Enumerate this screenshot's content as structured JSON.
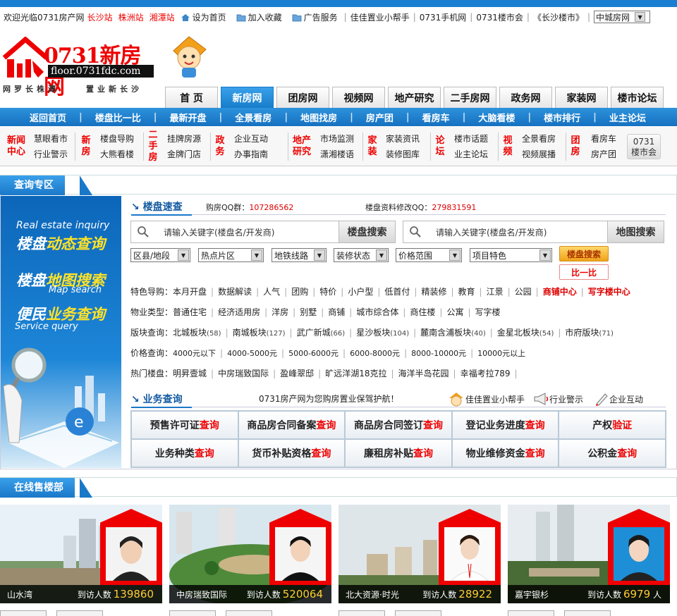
{
  "topbar": {
    "welcome": "欢迎光临0731房产网",
    "sites": [
      "长沙站",
      "株洲站",
      "湘潭站"
    ],
    "links": [
      "设为首页",
      "加入收藏",
      "广告服务"
    ],
    "text_links": [
      "佳佳置业小帮手",
      "0731手机网",
      "0731楼市会",
      "《长沙楼市》"
    ],
    "select_value": "中城房网"
  },
  "logo": {
    "brand": "0731新房网",
    "domain": "floor.0731fdc.com",
    "slogan_left": "网罗长株潭",
    "slogan_right": "置业新长沙"
  },
  "tabs": [
    "首 页",
    "新房网",
    "团房网",
    "视频网",
    "地产研究",
    "二手房网",
    "政务网",
    "家装网",
    "楼市论坛"
  ],
  "active_tab_index": 1,
  "nav": [
    "返回首页",
    "楼盘比一比",
    "最新开盘",
    "全景看房",
    "地图找房",
    "房产团",
    "看房车",
    "大脑看楼",
    "楼市排行",
    "业主论坛"
  ],
  "subnav": [
    {
      "cat": "新闻中心",
      "links": [
        "慧眼看市",
        "行业警示"
      ]
    },
    {
      "cat": "新房",
      "links": [
        "楼盘导购",
        "大熊看楼"
      ]
    },
    {
      "cat": "二手房",
      "links": [
        "挂牌房源",
        "金牌门店"
      ]
    },
    {
      "cat": "政务",
      "links": [
        "企业互动",
        "办事指南"
      ]
    },
    {
      "cat": "地产研究",
      "links": [
        "市场监测",
        "潇湘楼语"
      ]
    },
    {
      "cat": "家装",
      "links": [
        "家装资讯",
        "装修图库"
      ]
    },
    {
      "cat": "论坛",
      "links": [
        "楼市话题",
        "业主论坛"
      ]
    },
    {
      "cat": "视频",
      "links": [
        "全景看房",
        "视频展播"
      ]
    },
    {
      "cat": "团房",
      "links": [
        "看房车",
        "房产团"
      ]
    }
  ],
  "club_button": [
    "0731",
    "楼市会"
  ],
  "query_section": {
    "title": "查询专区"
  },
  "banner": {
    "en1": "Real estate inquiry",
    "cn1a": "楼盘",
    "cn1b": "动态查询",
    "cn2a": "楼盘",
    "cn2b": "地图搜索",
    "en2": "Map search",
    "cn3a": "便民",
    "cn3b": "业务查询",
    "en3": "Service query"
  },
  "quick": {
    "title": "楼盘速查",
    "qq_label": "购房QQ群：",
    "qq_value": "107286562",
    "edit_label": "楼盘资料修改QQ：",
    "edit_value": "279831591",
    "search1_placeholder": "请输入关键字(楼盘名/开发商)",
    "search1_button": "楼盘搜索",
    "search2_placeholder": "请输入关键字(楼盘名/开发商)",
    "search2_button": "地图搜索",
    "filters": [
      "区县/地段",
      "热点片区",
      "地铁线路",
      "装修状态",
      "价格范围",
      "项目特色"
    ],
    "btn_search": "楼盘搜索",
    "btn_compare": "比一比"
  },
  "features": {
    "label": "特色导购：",
    "items": [
      "本月开盘",
      "数据解读",
      "人气",
      "团购",
      "特价",
      "小户型",
      "低首付",
      "精装修",
      "教育",
      "江景",
      "公园"
    ],
    "red": [
      "商铺中心",
      "写字楼中心"
    ]
  },
  "property_types": {
    "label": "物业类型：",
    "items": [
      "普通住宅",
      "经济适用房",
      "洋房",
      "别墅",
      "商铺",
      "城市综合体",
      "商住楼",
      "公寓",
      "写字楼"
    ]
  },
  "blocks": {
    "label": "版块查询：",
    "items": [
      [
        "北城板块",
        "58"
      ],
      [
        "南城板块",
        "127"
      ],
      [
        "武广新城",
        "66"
      ],
      [
        "星沙板块",
        "104"
      ],
      [
        "麓南含浦板块",
        "40"
      ],
      [
        "金星北板块",
        "54"
      ],
      [
        "市府版块",
        "71"
      ]
    ]
  },
  "prices": {
    "label": "价格查询：",
    "items": [
      "4000元以下",
      "4000-5000元",
      "5000-6000元",
      "6000-8000元",
      "8000-10000元",
      "10000元以上"
    ]
  },
  "hot": {
    "label": "热门楼盘：",
    "items": [
      "明昇壹城",
      "中房瑞致国际",
      "盈峰翠邸",
      "旷远洋湖18克拉",
      "海洋半岛花园",
      "幸福考拉789"
    ]
  },
  "biz": {
    "title": "业务查询",
    "note": "0731房产网为您购房置业保驾护航！",
    "links": [
      "佳佳置业小帮手",
      "行业警示",
      "企业互动"
    ],
    "cells": [
      [
        "预售许可证",
        "查询"
      ],
      [
        "商品房合同备案",
        "查询"
      ],
      [
        "商品房合同签订",
        "查询"
      ],
      [
        "登记业务进度",
        "查询"
      ],
      [
        "产权",
        "验证"
      ],
      [
        "业务种类",
        "查询"
      ],
      [
        "货币补贴资格",
        "查询"
      ],
      [
        "廉租房补贴",
        "查询"
      ],
      [
        "物业维修资金",
        "查询"
      ],
      [
        "公积金",
        "查询"
      ]
    ]
  },
  "online_section": {
    "title": "在线售楼部"
  },
  "listings": [
    {
      "name": "山水湾",
      "visit_label": "到访人数",
      "count": "139860",
      "suffix": ""
    },
    {
      "name": "中房瑞致国际",
      "visit_label": "到访人数",
      "count": "520064",
      "suffix": ""
    },
    {
      "name": "北大资源·时光",
      "visit_label": "到访人数",
      "count": "28922",
      "suffix": ""
    },
    {
      "name": "嘉宇银杉",
      "visit_label": "到访人数",
      "count": "6979",
      "suffix": "人"
    }
  ],
  "colors": {
    "accent": "#1a78c8",
    "red": "#e00000",
    "gold": "#ffcc33"
  }
}
